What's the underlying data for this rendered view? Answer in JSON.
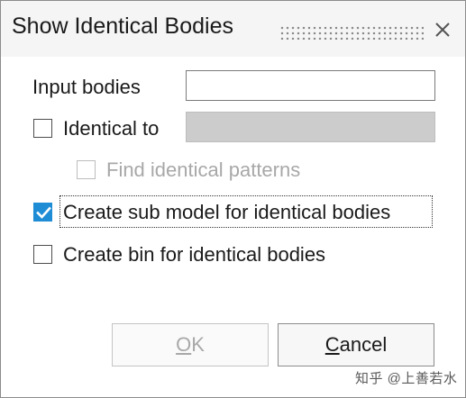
{
  "dialog": {
    "title": "Show Identical Bodies",
    "close_icon": "close-icon"
  },
  "form": {
    "input_bodies": {
      "label": "Input bodies",
      "value": ""
    },
    "identical_to": {
      "label": "Identical to",
      "checked": false,
      "value": ""
    },
    "find_patterns": {
      "label": "Find identical patterns",
      "checked": false,
      "enabled": false
    },
    "create_sub_model": {
      "label": "Create sub model for identical bodies",
      "checked": true
    },
    "create_bin": {
      "label": "Create bin for identical bodies",
      "checked": false
    }
  },
  "buttons": {
    "ok": {
      "mnemonic": "O",
      "rest": "K",
      "enabled": false
    },
    "cancel": {
      "mnemonic": "C",
      "rest": "ancel",
      "enabled": true
    }
  },
  "watermark": "知乎 @上善若水",
  "colors": {
    "accent": "#1f8dd6",
    "disabled_text": "#a8a8a8",
    "disabled_field": "#cccccc"
  }
}
